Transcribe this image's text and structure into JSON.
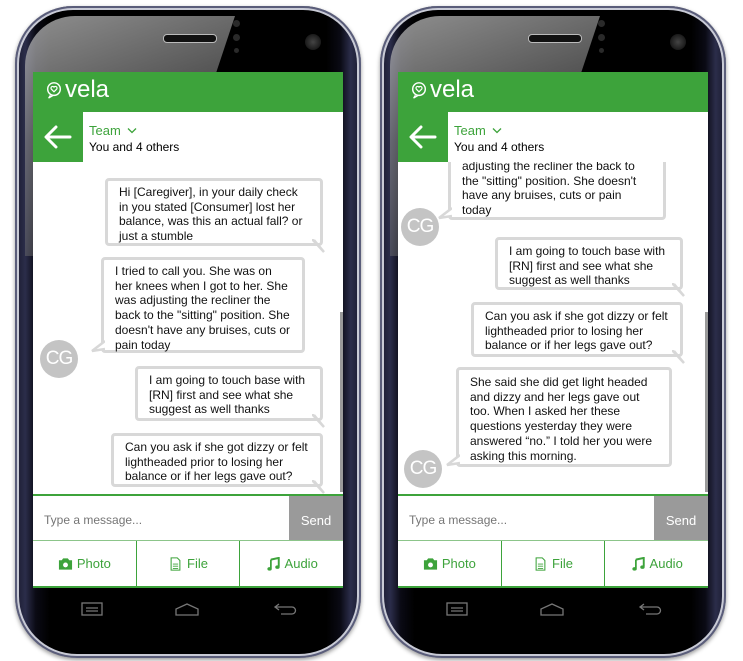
{
  "colors": {
    "brand": "#3da33b",
    "send_bg": "#9a9a9a",
    "bubble_border": "#d8d8d8",
    "avatar_bg": "#c4c4c4"
  },
  "phones": [
    {
      "app": {
        "name": "vela",
        "logo_icon": "heart-chat-icon"
      },
      "header": {
        "back_icon": "arrow-left-icon",
        "title": "Team",
        "title_icon": "chevron-down-icon",
        "subtitle": "You and 4 others"
      },
      "messages": [
        {
          "sender": "me",
          "text": "Hi [Caregiver], in your daily check in you stated [Consumer] lost her balance, was this an actual fall? or just a stumble"
        },
        {
          "sender": "CG",
          "avatar": "CG",
          "text": "I tried to call you. She was on her knees when I got to her. She was adjusting the recliner the back to the \"sitting\" position. She doesn't have any bruises, cuts or pain today"
        },
        {
          "sender": "me",
          "text": "I am going to touch base with [RN] first and see what she suggest as well thanks"
        },
        {
          "sender": "me",
          "text": "Can you ask if she got dizzy or felt lightheaded prior to losing her balance or if her legs gave out?"
        }
      ],
      "composer": {
        "placeholder": "Type a message...",
        "send_label": "Send"
      },
      "actions": [
        {
          "label": "Photo",
          "icon": "camera-icon"
        },
        {
          "label": "File",
          "icon": "file-icon"
        },
        {
          "label": "Audio",
          "icon": "music-note-icon"
        }
      ]
    },
    {
      "app": {
        "name": "vela",
        "logo_icon": "heart-chat-icon"
      },
      "header": {
        "back_icon": "arrow-left-icon",
        "title": "Team",
        "title_icon": "chevron-down-icon",
        "subtitle": "You and 4 others"
      },
      "messages": [
        {
          "sender": "CG",
          "avatar": "CG",
          "text": "adjusting the recliner the back to the \"sitting\" position. She doesn't have any bruises, cuts or pain today"
        },
        {
          "sender": "me",
          "text": "I am going to touch base with [RN] first and see what she suggest as well thanks"
        },
        {
          "sender": "me",
          "text": "Can you ask if she got dizzy or felt lightheaded prior to losing her balance or if her legs gave out?"
        },
        {
          "sender": "CG",
          "avatar": "CG",
          "text": "She said she did get light headed and dizzy and her legs gave out too.  When I asked her these questions yesterday they were answered “no.” I told her you were asking this morning."
        }
      ],
      "composer": {
        "placeholder": "Type a message...",
        "send_label": "Send"
      },
      "actions": [
        {
          "label": "Photo",
          "icon": "camera-icon"
        },
        {
          "label": "File",
          "icon": "file-icon"
        },
        {
          "label": "Audio",
          "icon": "music-note-icon"
        }
      ]
    }
  ]
}
